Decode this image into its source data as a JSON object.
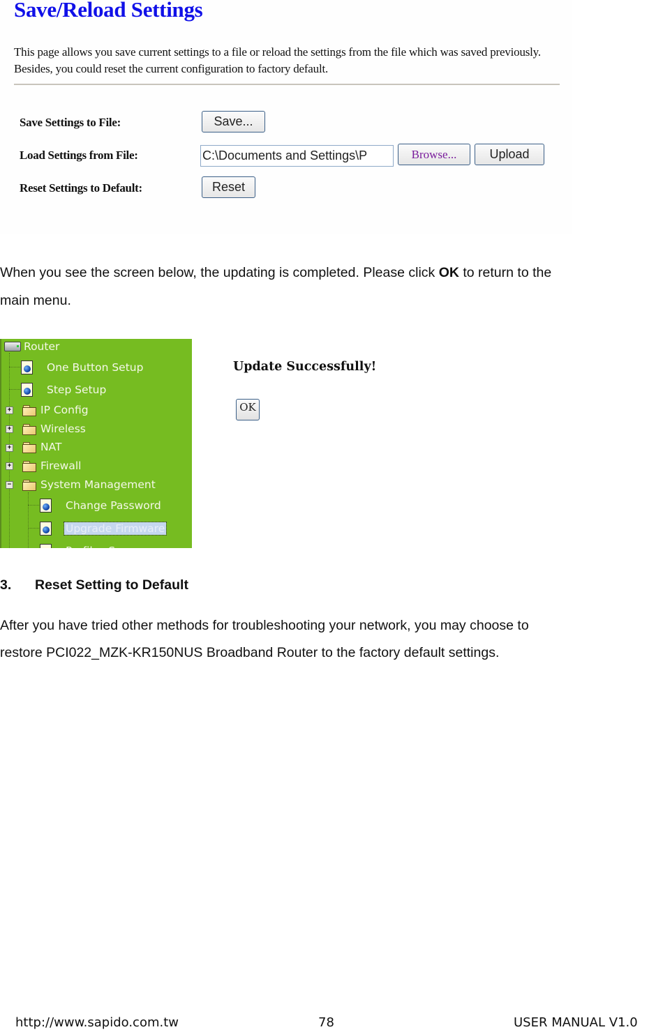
{
  "save_reload_screenshot": {
    "title": "Save/Reload Settings",
    "description": "This page allows you save current settings to a file or reload the settings from the file which was saved previously. Besides, you could reset the current configuration to factory default.",
    "rows": [
      {
        "label": "Save Settings to File:",
        "button": "Save..."
      },
      {
        "label": "Load Settings from File:",
        "file_value": "C:\\Documents and Settings\\P",
        "browse_button": "Browse...",
        "upload_button": "Upload"
      },
      {
        "label": "Reset Settings to Default:",
        "button": "Reset"
      }
    ]
  },
  "paragraph1": {
    "before": "When you see the screen below, the updating is completed. Please click ",
    "bold": "OK",
    "after": " to return to the",
    "line2": "main menu."
  },
  "update_screenshot": {
    "tree": {
      "root": "Router",
      "items": [
        {
          "label": "One Button Setup",
          "type": "page"
        },
        {
          "label": "Step Setup",
          "type": "page"
        },
        {
          "label": "IP Config",
          "type": "folder",
          "expander": "+"
        },
        {
          "label": "Wireless",
          "type": "folder",
          "expander": "+"
        },
        {
          "label": "NAT",
          "type": "folder",
          "expander": "+"
        },
        {
          "label": "Firewall",
          "type": "folder",
          "expander": "+"
        },
        {
          "label": "System Management",
          "type": "folder-open",
          "expander": "−"
        },
        {
          "label": "Change Password",
          "type": "page"
        },
        {
          "label": "Upgrade Firmware",
          "type": "page",
          "selected": true
        },
        {
          "label": "Profiles Save",
          "type": "page"
        }
      ]
    },
    "message": "Update Successfully!",
    "ok_button": "OK"
  },
  "section3": {
    "number": "3.",
    "title": "Reset Setting to Default",
    "line1": "After you have tried other methods for troubleshooting your network, you may choose to",
    "line2": "restore PCI022_MZK-KR150NUS Broadband Router to the factory default settings."
  },
  "footer": {
    "url": "http://www.sapido.com.tw",
    "page": "78",
    "manual": "USER MANUAL V1.0"
  }
}
